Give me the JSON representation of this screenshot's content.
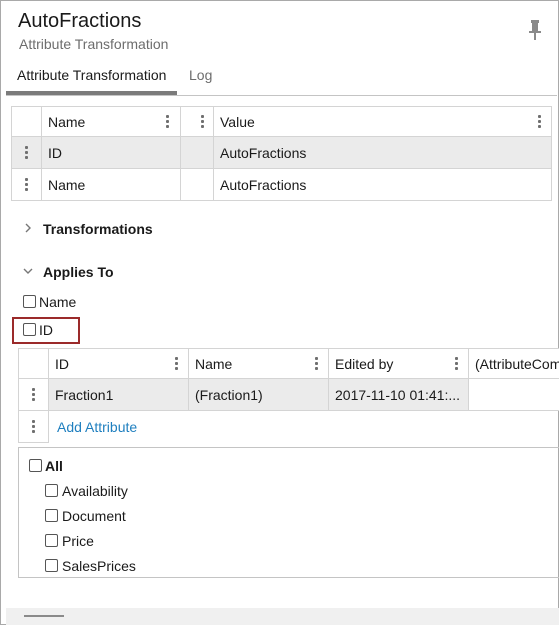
{
  "header": {
    "title": "AutoFractions",
    "subtitle": "Attribute Transformation"
  },
  "tabs": [
    {
      "label": "Attribute Transformation",
      "active": true
    },
    {
      "label": "Log",
      "active": false
    }
  ],
  "props_table": {
    "columns": [
      "Name",
      "",
      "Value"
    ],
    "rows": [
      {
        "name": "ID",
        "value": "AutoFractions"
      },
      {
        "name": "Name",
        "value": "AutoFractions"
      }
    ]
  },
  "sections": {
    "transformations": {
      "label": "Transformations",
      "expanded": false
    },
    "applies_to": {
      "label": "Applies To",
      "expanded": true
    }
  },
  "applies_to_options": [
    {
      "label": "Name",
      "checked": false
    },
    {
      "label": "ID",
      "checked": false
    }
  ],
  "id_table": {
    "columns": [
      "ID",
      "Name",
      "Edited by",
      "(AttributeCom"
    ],
    "rows": [
      {
        "id": "Fraction1",
        "name": "(Fraction1)",
        "edited_by": "2017-11-10 01:41:..."
      }
    ],
    "add_link": "Add Attribute"
  },
  "attribute_list": {
    "all_label": "All",
    "items": [
      "Availability",
      "Document",
      "Price",
      "SalesPrices"
    ]
  },
  "colors": {
    "highlight": "#9b2a2a",
    "link": "#1f7fbf",
    "row_bg": "#ebebeb"
  },
  "icons": [
    "pin-icon",
    "chevron-right-icon",
    "chevron-down-icon",
    "kebab-menu-icon"
  ]
}
